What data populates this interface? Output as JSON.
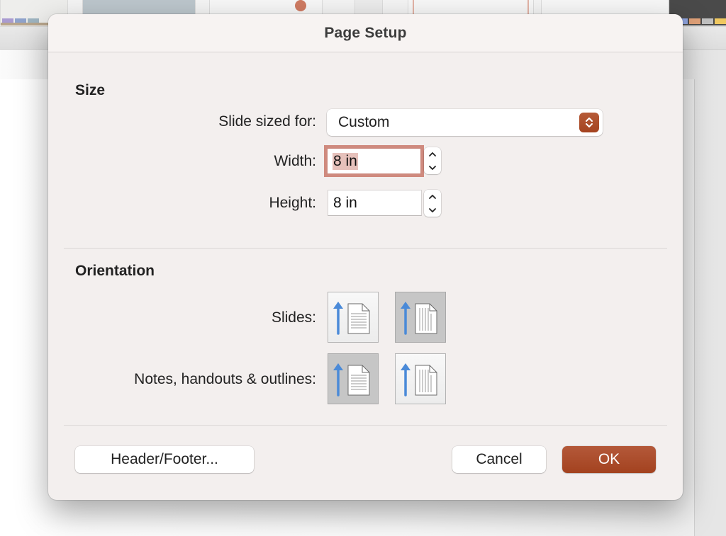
{
  "dialog": {
    "title": "Page Setup"
  },
  "size_section": {
    "title": "Size",
    "slide_sized_for": {
      "label": "Slide sized for:",
      "selected": "Custom"
    },
    "width": {
      "label": "Width:",
      "value": "8 in",
      "focused": true
    },
    "height": {
      "label": "Height:",
      "value": "8 in"
    }
  },
  "orientation_section": {
    "title": "Orientation",
    "slides": {
      "label": "Slides:",
      "options": [
        {
          "name": "portrait",
          "selected": false
        },
        {
          "name": "landscape",
          "selected": true
        }
      ]
    },
    "notes": {
      "label": "Notes, handouts & outlines:",
      "options": [
        {
          "name": "portrait",
          "selected": true
        },
        {
          "name": "landscape",
          "selected": false
        }
      ]
    }
  },
  "buttons": {
    "header_footer": "Header/Footer...",
    "cancel": "Cancel",
    "ok": "OK"
  },
  "colors": {
    "accent": "#a8482a",
    "focus_ring": "#cf8a7e",
    "arrow_blue": "#4a8ad8"
  }
}
